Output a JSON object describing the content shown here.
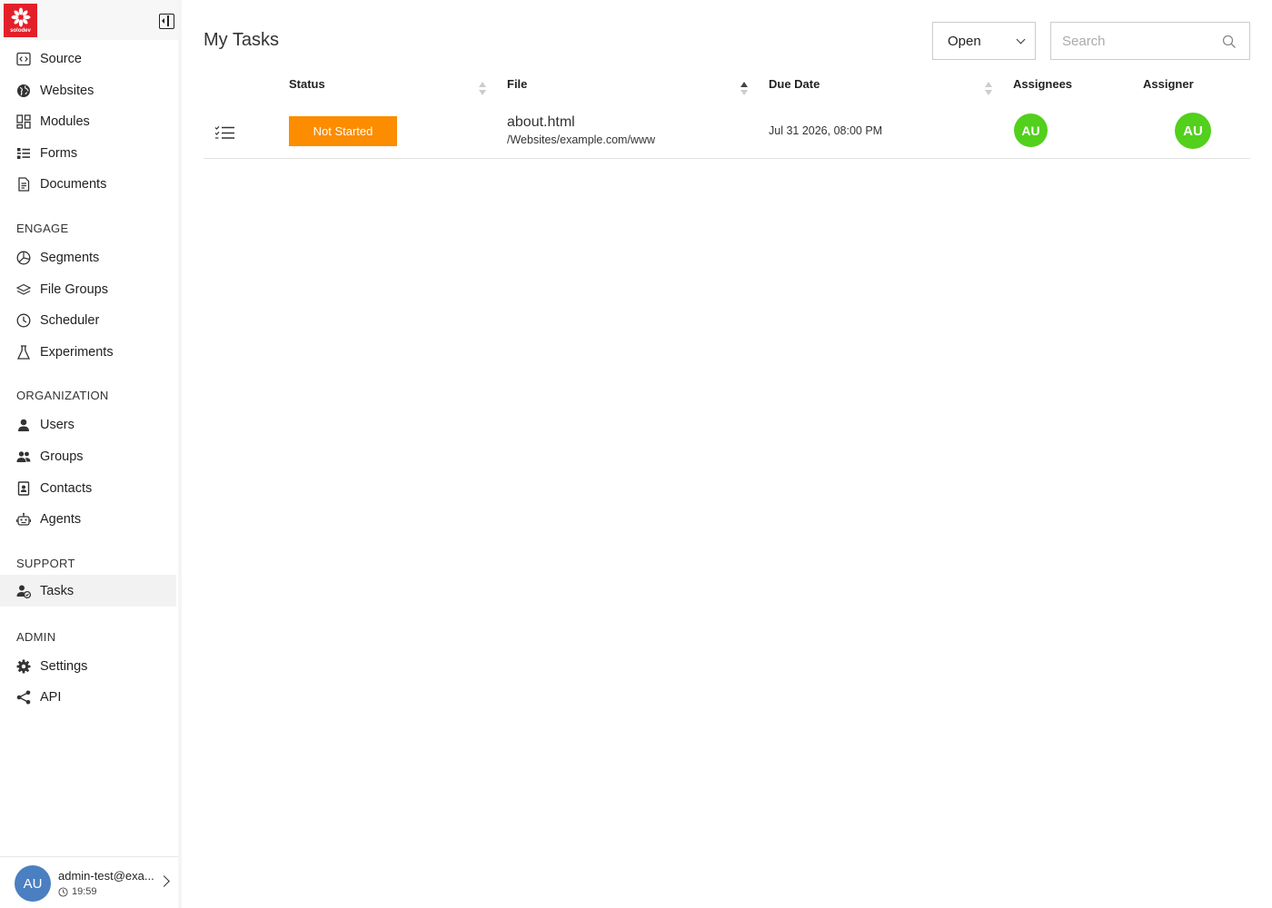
{
  "brand": {
    "logo_text": "solodev",
    "accent": "#e3202a"
  },
  "sidebar": {
    "primary_items": [
      {
        "label": "Source",
        "icon": "code-icon"
      },
      {
        "label": "Websites",
        "icon": "globe-icon"
      },
      {
        "label": "Modules",
        "icon": "modules-icon"
      },
      {
        "label": "Forms",
        "icon": "forms-icon"
      },
      {
        "label": "Documents",
        "icon": "document-icon"
      }
    ],
    "sections": [
      {
        "title": "ENGAGE",
        "items": [
          {
            "label": "Segments",
            "icon": "pie-icon"
          },
          {
            "label": "File Groups",
            "icon": "layers-icon"
          },
          {
            "label": "Scheduler",
            "icon": "clock-icon"
          },
          {
            "label": "Experiments",
            "icon": "flask-icon"
          }
        ]
      },
      {
        "title": "ORGANIZATION",
        "items": [
          {
            "label": "Users",
            "icon": "user-icon"
          },
          {
            "label": "Groups",
            "icon": "users-icon"
          },
          {
            "label": "Contacts",
            "icon": "contact-icon"
          },
          {
            "label": "Agents",
            "icon": "robot-icon"
          }
        ]
      },
      {
        "title": "SUPPORT",
        "items": [
          {
            "label": "Tasks",
            "icon": "task-user-icon",
            "active": true
          }
        ]
      },
      {
        "title": "ADMIN",
        "items": [
          {
            "label": "Settings",
            "icon": "gear-icon"
          },
          {
            "label": "API",
            "icon": "share-icon"
          }
        ]
      }
    ]
  },
  "user": {
    "initials": "AU",
    "email": "admin-test@exa...",
    "time": "19:59",
    "avatar_color": "#4a7fc1"
  },
  "main": {
    "title": "My Tasks",
    "filter": {
      "selected": "Open"
    },
    "search": {
      "placeholder": "Search",
      "value": ""
    },
    "columns": {
      "status": "Status",
      "file": "File",
      "due_date": "Due Date",
      "assignees": "Assignees",
      "assigner": "Assigner"
    },
    "sort": {
      "column": "file",
      "direction": "ascending"
    },
    "rows": [
      {
        "status": "Not Started",
        "status_color": "#fc8c00",
        "file_name": "about.html",
        "file_path": "/Websites/example.com/www",
        "due_date": "Jul 31 2026, 08:00 PM",
        "assignee_initials": "AU",
        "assigner_initials": "AU",
        "avatar_color": "#52d01c"
      }
    ]
  }
}
